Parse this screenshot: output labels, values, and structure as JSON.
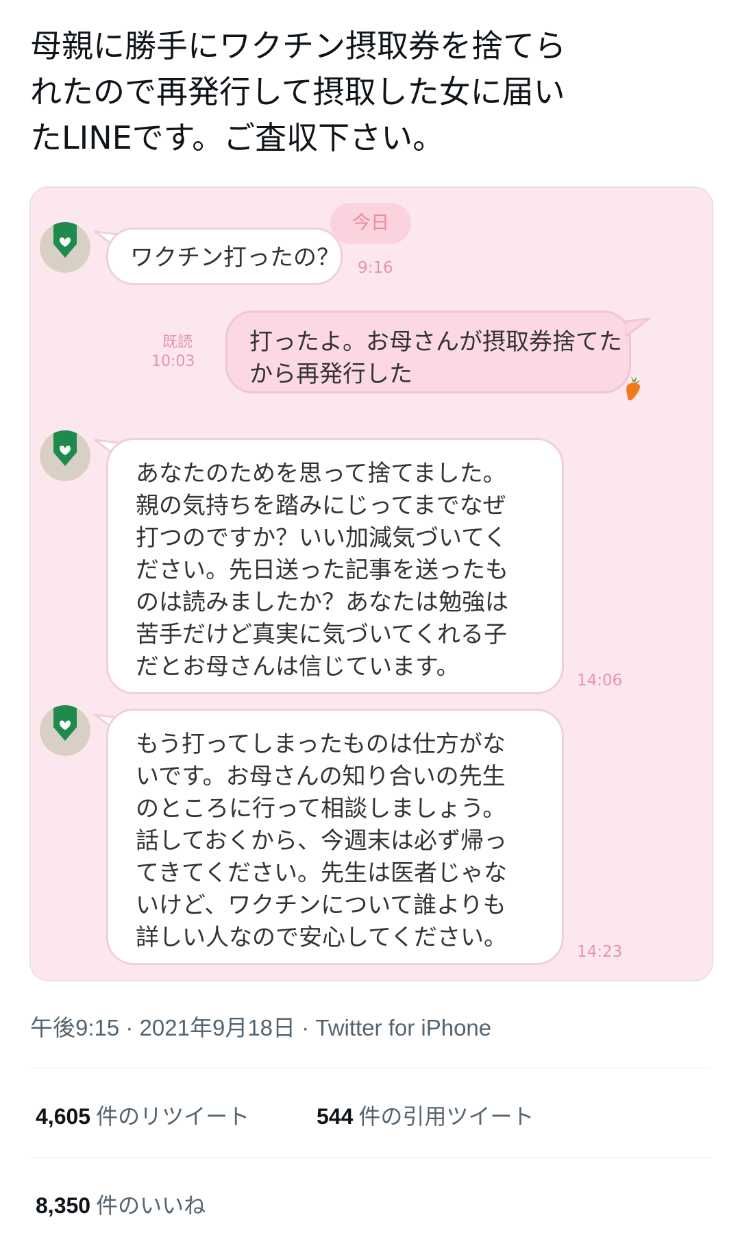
{
  "tweet": {
    "text": "母親に勝手にワクチン摂取券を捨てら\nれたので再発行して摂取した女に届い\nたLINEです。ご査収下さい。",
    "meta": "午後9:15 · 2021年9月18日 · Twitter for iPhone"
  },
  "chat": {
    "date_label": "今日",
    "read_label": "既読",
    "messages": [
      {
        "text": "ワクチン打ったの？",
        "time": "9:16"
      },
      {
        "text": "打ったよ。お母さんが摂取券捨てた\nから再発行した",
        "time": "10:03"
      },
      {
        "text": "あなたのためを思って捨てました。\n親の気持ちを踏みにじってまでなぜ\n打つのですか？いい加減気づいてく\nださい。先日送った記事を送ったも\nのは読みましたか？あなたは勉強は\n苦手だけど真実に気づいてくれる子\nだとお母さんは信じています。",
        "time": "14:06"
      },
      {
        "text": "もう打ってしまったものは仕方がな\nいです。お母さんの知り合いの先生\nのところに行って相談しましょう。\n話しておくから、今週末は必ず帰っ\nてきてください。先生は医者じゃな\nいけど、ワクチンについて誰よりも\n詳しい人なので安心してください。",
        "time": "14:23"
      }
    ]
  },
  "stats": {
    "retweets_count": "4,605",
    "retweets_label": "件のリツイート",
    "quotes_count": "544",
    "quotes_label": "件の引用ツイート",
    "likes_count": "8,350",
    "likes_label": "件のいいね"
  },
  "colors": {
    "chat_background": "#fde7ee",
    "incoming_bubble": "#ffffff",
    "outgoing_bubble": "#fbd8e4",
    "time_text": "#e195aa",
    "avatar_green": "#1f8a4c"
  },
  "icons": {
    "avatar": "green-pencil-heart-avatar-icon",
    "sticker": "carrot-icon"
  }
}
